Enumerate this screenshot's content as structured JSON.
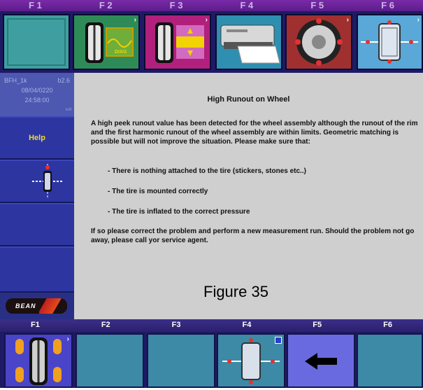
{
  "top_bar": {
    "labels": [
      "F 1",
      "F 2",
      "F 3",
      "F 4",
      "F 5",
      "F 6"
    ],
    "buttons": [
      {
        "icon": "blank-panel-icon",
        "color": "#3f9fa0"
      },
      {
        "icon": "wheel-diag-icon",
        "color": "#2e8b58",
        "badge": "DIAG",
        "arrow": "›"
      },
      {
        "icon": "wheel-balance-icon",
        "color": "#b0207c",
        "arrow": "›"
      },
      {
        "icon": "printer-icon",
        "color": "#2f8fb0"
      },
      {
        "icon": "wheel-target-icon",
        "color": "#a03030",
        "arrow": "›"
      },
      {
        "icon": "wheel-axle-icon",
        "color": "#5aa8d8",
        "arrow": "›"
      }
    ]
  },
  "sidebar": {
    "info": {
      "model": "BFH_1k",
      "version": "b2.6",
      "date": "08/04/0220",
      "time": "24:58:00",
      "corner": "wdr"
    },
    "help_label": "Help",
    "logo_text": "BEAN"
  },
  "main": {
    "title": "High Runout on Wheel",
    "paragraph1": "A high peek runout value has been detected for the wheel assembly although the runout of the rim and the first harmonic runout of the wheel assembly are within limits. Geometric matching is possible but will not improve the situation. Please make sure that:",
    "bullets": [
      "-  There is nothing attached to the tire (stickers, stones etc..)",
      "-  The tire is mounted correctly",
      "-  The tire is inflated to the correct pressure"
    ],
    "paragraph2": "If so please correct the problem and perform a new measurement run. Should the problem not go away, please call yor service agent.",
    "figure_caption": "Figure 35"
  },
  "bottom_bar": {
    "labels": [
      "F1",
      "F2",
      "F3",
      "F4",
      "F5",
      "F6"
    ],
    "buttons": [
      {
        "icon": "tire-layout-icon",
        "arrow": "›"
      },
      {
        "icon": "empty-button"
      },
      {
        "icon": "empty-button"
      },
      {
        "icon": "wheel-axle-check-icon"
      },
      {
        "icon": "back-arrow-icon"
      },
      {
        "icon": "empty-button"
      }
    ]
  }
}
